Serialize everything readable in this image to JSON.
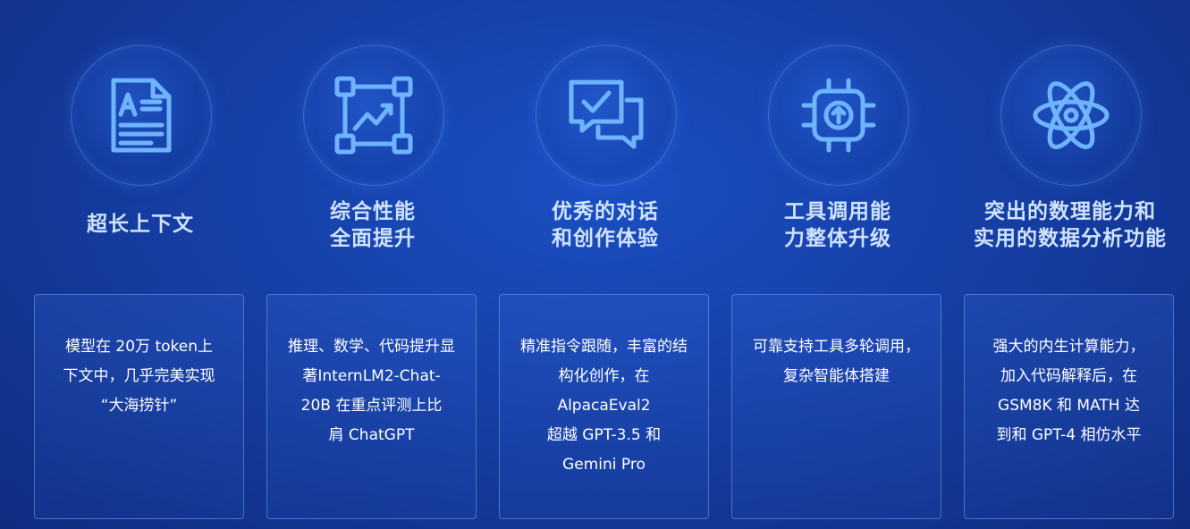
{
  "colors": {
    "background": "#163fa6",
    "icon_stroke": "#6fb4ff",
    "title": "#cfe3ff",
    "card_border": "#8cb4ff"
  },
  "features": [
    {
      "icon": "document-text-icon",
      "title": "超长上下文",
      "description": "模型在 20万 token上\n下文中，几乎完美实现\n“大海捞针”"
    },
    {
      "icon": "chart-growth-icon",
      "title": "综合性能\n全面提升",
      "description": "推理、数学、代码提升显\n著InternLM2-Chat-\n20B 在重点评测上比\n肩 ChatGPT"
    },
    {
      "icon": "chat-check-icon",
      "title": "优秀的对话\n和创作体验",
      "description": "精准指令跟随，丰富的结\n构化创作，在\nAlpacaEval2\n超越 GPT-3.5 和\nGemini Pro"
    },
    {
      "icon": "chip-upgrade-icon",
      "title": "工具调用能\n力整体升级",
      "description": "可靠支持工具多轮调用，\n复杂智能体搭建"
    },
    {
      "icon": "atom-icon",
      "title": "突出的数理能力和\n实用的数据分析功能",
      "description": "强大的内生计算能力，\n加入代码解释后，在\nGSM8K 和 MATH 达\n到和 GPT-4 相仿水平"
    }
  ]
}
